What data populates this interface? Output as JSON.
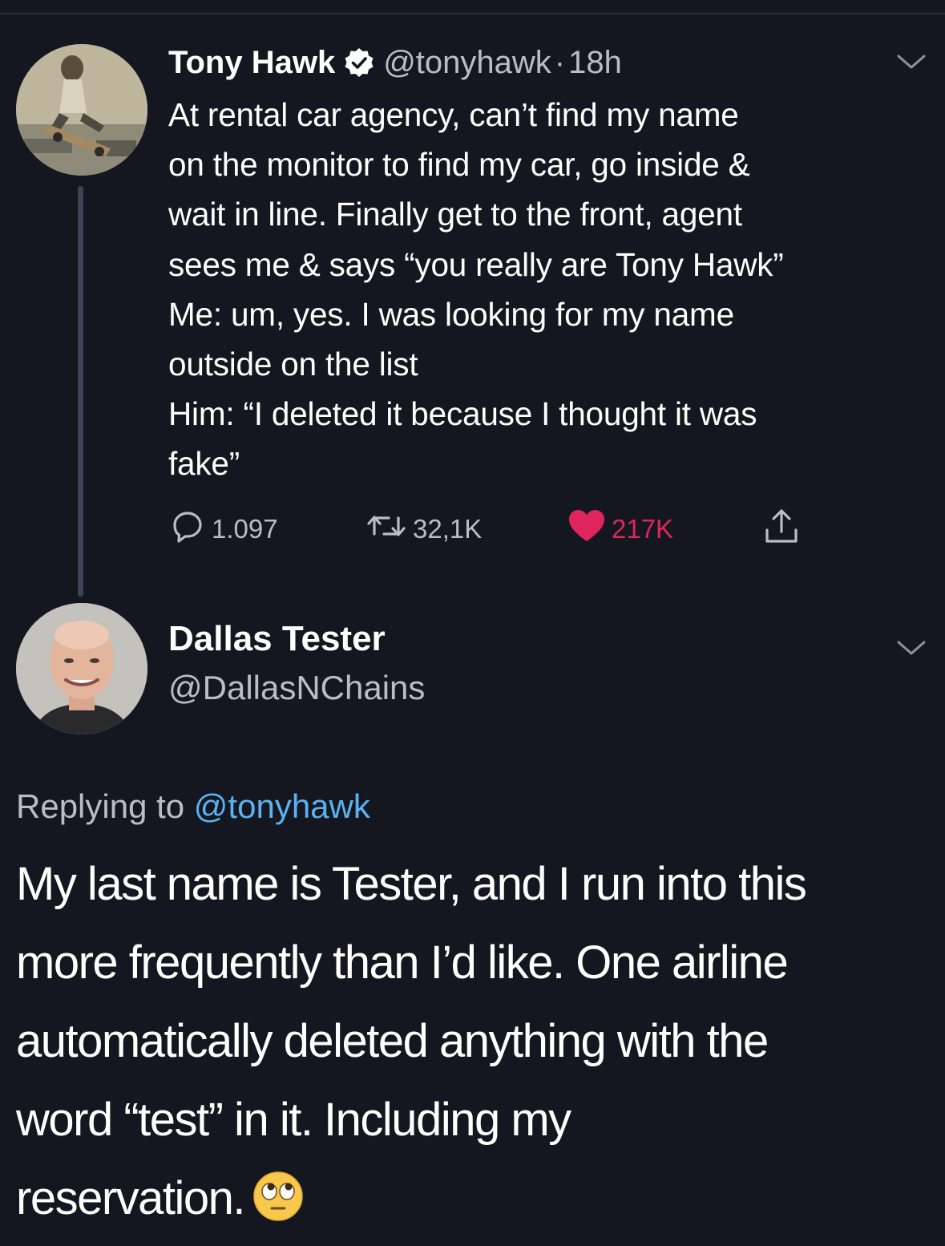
{
  "tweet": {
    "author_name": "Tony Hawk",
    "handle": "@tonyhawk",
    "separator": "·",
    "time": "18h",
    "verified": true,
    "body_lines": [
      "At rental car agency, can’t find my name",
      "on the monitor to find my car, go inside &",
      "wait in line. Finally get to the front, agent",
      "sees me & says “you really are Tony Hawk”",
      "Me: um, yes. I was looking for my name",
      "outside on the list",
      "Him: “I deleted it because I thought it was",
      "fake”"
    ],
    "actions": {
      "replies": "1.097",
      "retweets": "32,1K",
      "likes": "217K"
    },
    "colors": {
      "like": "#e0245e",
      "verified": "#ffffff"
    }
  },
  "reply": {
    "author_name": "Dallas Tester",
    "handle": "@DallasNChains",
    "replying_prefix": "Replying to",
    "replying_mention": "@tonyhawk",
    "body_lines": [
      "My last name is Tester, and I run into this",
      "more frequently than I’d like. One airline",
      "automatically deleted anything with the",
      "word “test” in it. Including my",
      "reservation."
    ],
    "emoji": "face-with-rolling-eyes",
    "colors": {
      "mention": "#5bb2f0"
    }
  }
}
